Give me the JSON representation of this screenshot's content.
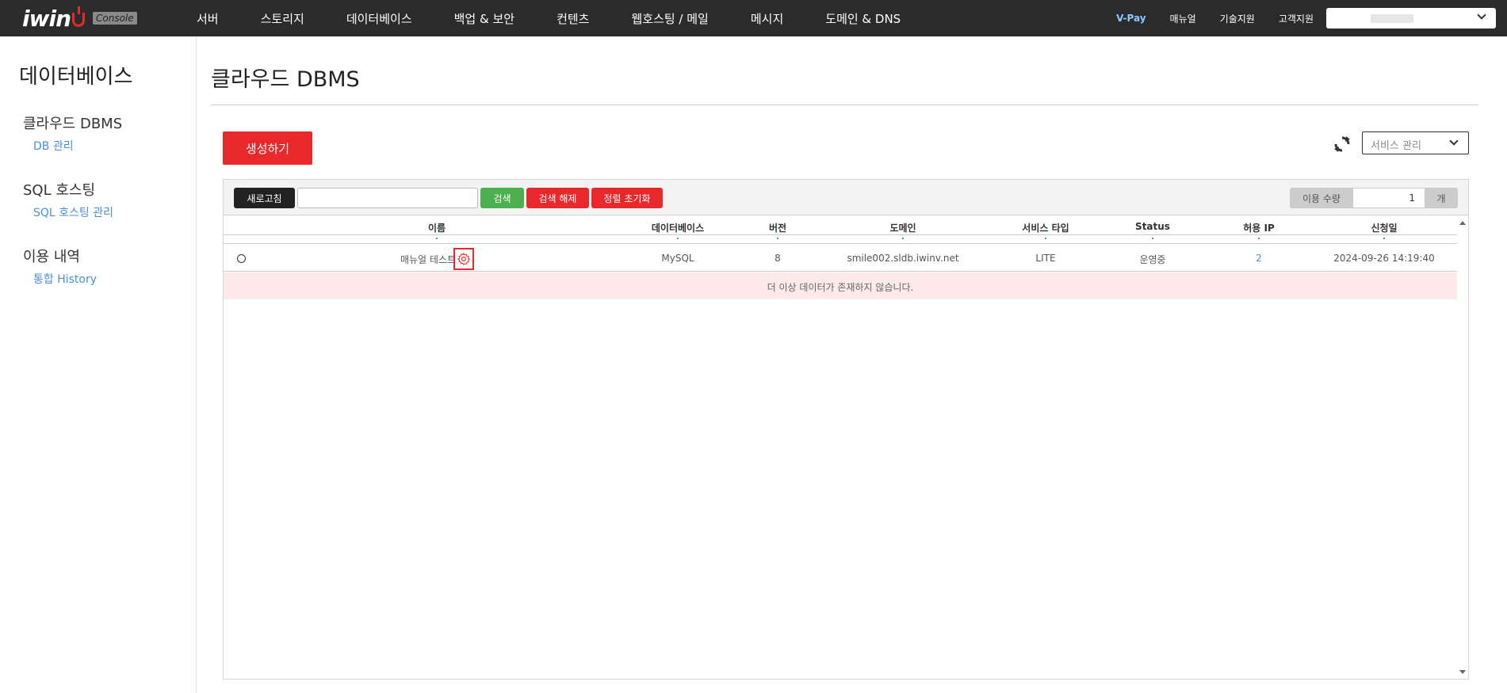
{
  "header": {
    "logo": "iwin",
    "console_badge": "Console",
    "menu": [
      "서버",
      "스토리지",
      "데이터베이스",
      "백업 & 보안",
      "컨텐츠",
      "웹호스팅 / 메일",
      "메시지",
      "도메인 & DNS"
    ],
    "right_menu": [
      "V-Pay",
      "매뉴얼",
      "기술지원",
      "고객지원"
    ]
  },
  "sidebar": {
    "title": "데이터베이스",
    "groups": [
      {
        "label": "클라우드 DBMS",
        "items": [
          "DB 관리"
        ]
      },
      {
        "label": "SQL 호스팅",
        "items": [
          "SQL 호스팅 관리"
        ]
      },
      {
        "label": "이용 내역",
        "items": [
          "통합 History"
        ]
      }
    ]
  },
  "main": {
    "title": "클라우드 DBMS",
    "create_label": "생성하기",
    "service_select": "서비스 관리"
  },
  "toolbar": {
    "refresh": "새로고침",
    "search_value": "",
    "search": "검색",
    "clear": "검색 해제",
    "sort_reset": "정렬 초기화",
    "qty_label": "이용 수량",
    "qty_value": "1",
    "qty_unit": "개"
  },
  "table": {
    "columns": [
      "이름",
      "데이터베이스",
      "버전",
      "도메인",
      "서비스 타입",
      "Status",
      "허용 IP",
      "신청일"
    ],
    "rows": [
      {
        "name": "매뉴얼 테스트",
        "database": "MySQL",
        "version": "8",
        "domain": "smile002.sldb.iwinv.net",
        "service_type": "LITE",
        "status": "운영중",
        "allowed_ip": "2",
        "date": "2024-09-26 14:19:40"
      }
    ],
    "empty_message": "더 이상 데이터가 존재하지 않습니다."
  },
  "colors": {
    "brand_red": "#e8282b",
    "search_green": "#4cb050",
    "link_blue": "#4a90d9"
  }
}
